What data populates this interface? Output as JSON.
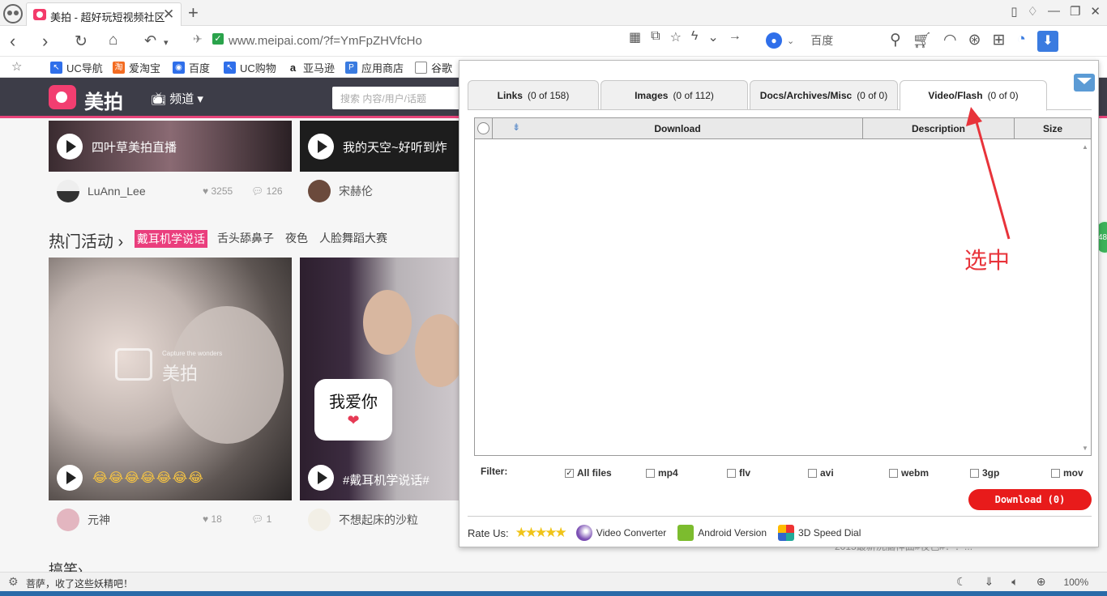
{
  "browser": {
    "tab_title": "美拍 - 超好玩短视频社区",
    "url": "www.meipai.com/?f=YmFpZHVfcHo",
    "search_engine": "百度",
    "bookmarks": [
      "UC导航",
      "爱淘宝",
      "百度",
      "UC购物",
      "亚马逊",
      "应用商店",
      "谷歌"
    ]
  },
  "site": {
    "name": "美拍",
    "channel": "频道",
    "search_placeholder": "搜索 内容/用户/话题",
    "videos_top": [
      {
        "caption": "四叶草美拍直播",
        "user": "LuAnn_Lee",
        "likes": "3255",
        "comments": "126"
      },
      {
        "caption": "我的天空~好听到炸",
        "user": "宋赫伦"
      }
    ],
    "hot_title": "热门活动",
    "hot_tags": [
      "戴耳机学说话",
      "舌头舔鼻子",
      "夜色",
      "人脸舞蹈大赛"
    ],
    "videos_bottom": [
      {
        "caption": "😂😂😂😂😂😂😂",
        "user": "元神",
        "likes": "18",
        "comments": "1",
        "watermark": "美拍",
        "watermark_sub": "Capture the wonders"
      },
      {
        "caption": "#戴耳机学说话#",
        "user": "不想起床的沙粒",
        "bubble": "我爱你"
      }
    ],
    "more_title": "搞笑",
    "right_ad": "2015最新洗脑神曲#夜色#！！...",
    "badge": "48"
  },
  "panel": {
    "tabs": [
      {
        "name": "Links",
        "count": "(0 of 158)"
      },
      {
        "name": "Images",
        "count": "(0 of 112)"
      },
      {
        "name": "Docs/Archives/Misc",
        "count": "(0 of 0)"
      },
      {
        "name": "Video/Flash",
        "count": "(0 of 0)"
      }
    ],
    "active_tab": "Video/Flash",
    "columns": [
      "Download",
      "Description",
      "Size"
    ],
    "filter_label": "Filter:",
    "filters": [
      {
        "label": "All files",
        "checked": true
      },
      {
        "label": "mp4",
        "checked": false
      },
      {
        "label": "flv",
        "checked": false
      },
      {
        "label": "avi",
        "checked": false
      },
      {
        "label": "webm",
        "checked": false
      },
      {
        "label": "3gp",
        "checked": false
      },
      {
        "label": "mov",
        "checked": false
      }
    ],
    "download_button": "Download (0)",
    "rate_us": "Rate Us:",
    "links": [
      "Video Converter",
      "Android Version",
      "3D Speed Dial"
    ]
  },
  "annotation": "选中",
  "status": {
    "text": "菩萨，收了这些妖精吧！",
    "zoom": "100%"
  },
  "colors": {
    "accent_pink": "#ea3e7d",
    "download_red": "#e81b1b",
    "annotation_red": "#e8333a"
  }
}
